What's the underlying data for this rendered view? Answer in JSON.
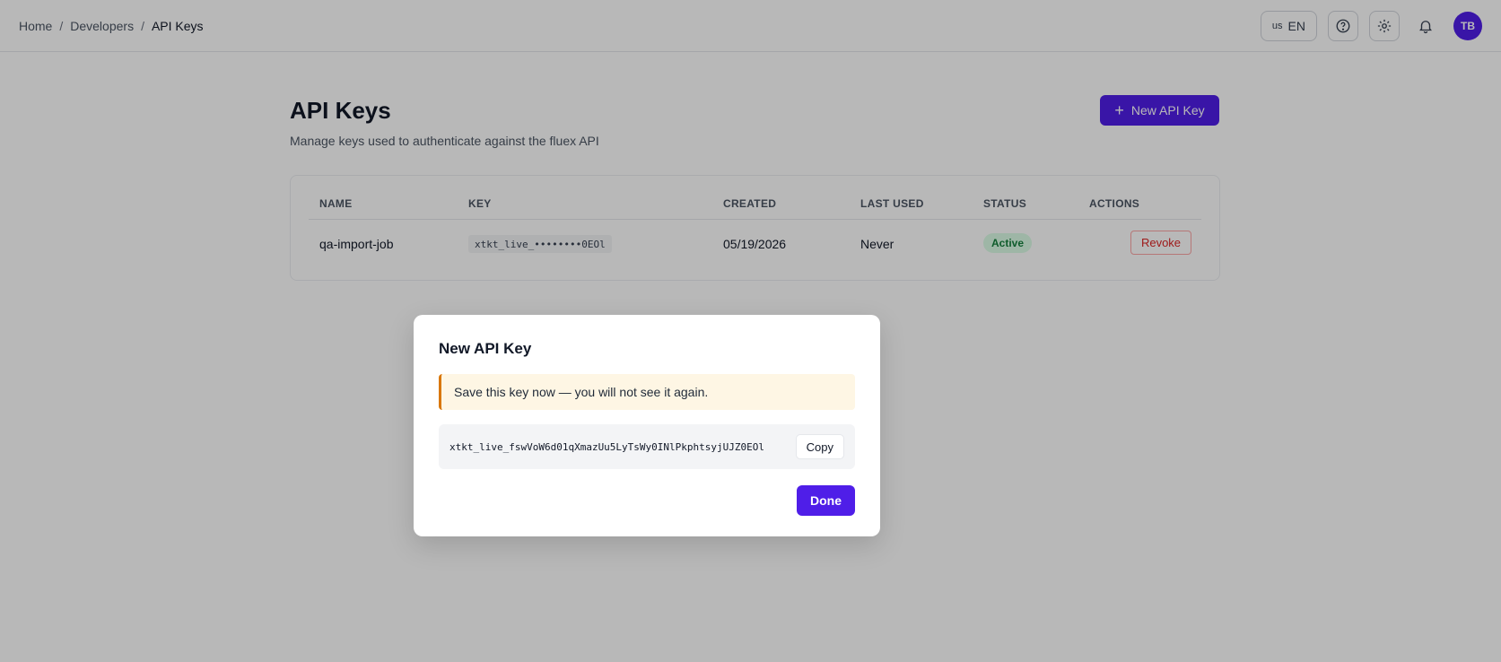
{
  "breadcrumb": {
    "items": [
      "Home",
      "Developers",
      "API Keys"
    ],
    "separator": "/"
  },
  "header": {
    "lang_flag": "us",
    "lang_label": "EN",
    "icons": [
      "help-icon",
      "gear-icon",
      "bell-icon"
    ],
    "avatar_initials": "TB"
  },
  "page": {
    "title": "API Keys",
    "subtitle": "Manage keys used to authenticate against the fluex API",
    "new_key_label": "New API Key"
  },
  "table": {
    "columns": [
      "NAME",
      "KEY",
      "CREATED",
      "LAST USED",
      "STATUS",
      "ACTIONS"
    ],
    "rows": [
      {
        "name": "qa-import-job",
        "key": "xtkt_live_••••••••0EOl",
        "created": "05/19/2026",
        "last_used": "Never",
        "status": "Active",
        "action": "Revoke"
      }
    ]
  },
  "modal": {
    "title": "New API Key",
    "warning": "Save this key now — you will not see it again.",
    "key_value": "xtkt_live_fswVoW6d01qXmazUu5LyTsWy0INlPkphtsyjUJZ0EOl",
    "copy_label": "Copy",
    "done_label": "Done"
  },
  "colors": {
    "accent": "#4f1ee8",
    "status_active_bg": "#dcfce7",
    "status_active_text": "#15803d",
    "danger": "#dc2626",
    "warning_border": "#d97706",
    "warning_bg": "#fef6e4"
  }
}
